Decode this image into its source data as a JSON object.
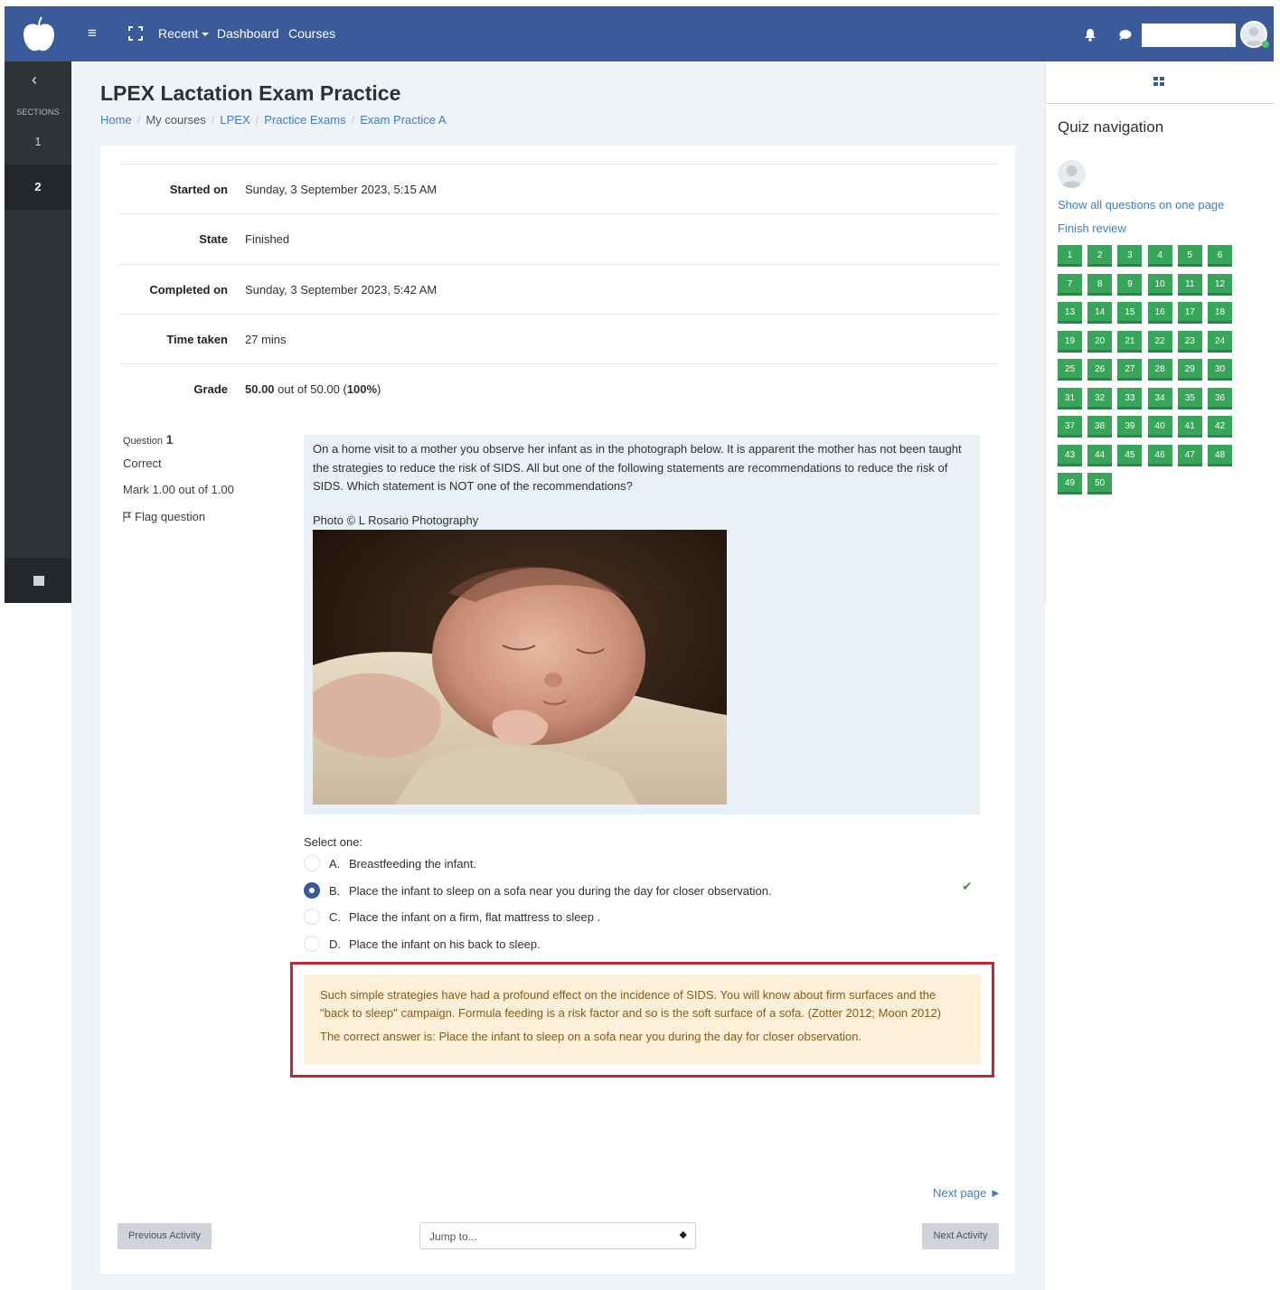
{
  "topnav": {
    "menu_icon": "hamburger-icon",
    "fullscreen_icon": "fullscreen-icon",
    "recent_label": "Recent",
    "dashboard_label": "Dashboard",
    "courses_label": "Courses",
    "notifications_icon": "bell-icon",
    "messages_icon": "chat-bubble-icon",
    "search_value": "",
    "brand_color": "#3a5a99"
  },
  "sections_drawer": {
    "back_icon": "chevron-left-icon",
    "title": "SECTIONS",
    "items": [
      "1",
      "2"
    ],
    "active_item": "2",
    "bottom_icon": "archive-icon"
  },
  "page": {
    "title": "LPEX Lactation Exam Practice",
    "breadcrumb": [
      "Home",
      "My courses",
      "LPEX",
      "Practice Exams",
      "Exam Practice A"
    ]
  },
  "summary": {
    "started_on_label": "Started on",
    "started_on_value": "Sunday, 3 September 2023, 5:15 AM",
    "state_label": "State",
    "state_value": "Finished",
    "completed_on_label": "Completed on",
    "completed_on_value": "Sunday, 3 September 2023, 5:42 AM",
    "time_taken_label": "Time taken",
    "time_taken_value": "27 mins",
    "grade_label": "Grade",
    "grade_score": "50.00",
    "grade_middle": " out of 50.00 (",
    "grade_percent": "100%",
    "grade_end": ")"
  },
  "question": {
    "question_word": "Question",
    "number": "1",
    "status": "Correct",
    "mark": "Mark 1.00 out of 1.00",
    "flag_label": "Flag question",
    "flag_icon": "flag-icon",
    "text": "On a home visit to a mother you observe her infant as in the photograph below. It is apparent the mother has not been taught the strategies to reduce the risk of SIDS. All but one of the following statements are recommendations to reduce the risk of SIDS. Which statement is NOT one of the recommendations?",
    "photo_credit": "Photo © L Rosario Photography",
    "select_one": "Select one:",
    "options": [
      {
        "letter": "A.",
        "text": "Breastfeeding the infant."
      },
      {
        "letter": "B.",
        "text": "Place the infant to sleep on a sofa near you during the day for closer observation."
      },
      {
        "letter": "C.",
        "text": "Place the infant on a firm, flat mattress to sleep ."
      },
      {
        "letter": "D.",
        "text": "Place the infant on his back to sleep."
      }
    ],
    "selected_option": "B.",
    "correct_icon": "checkmark-icon",
    "feedback_general": "Such simple strategies have had a profound effect on the incidence of SIDS. You will know about firm surfaces and the \"back to sleep\" campaign. Formula feeding is a risk factor and so is the soft surface of a sofa. (Zotter 2012; Moon 2012)",
    "feedback_answer": "The correct answer is: Place the infant to sleep on a sofa near you during the day for closer observation.",
    "highlight_color": "#c3272f"
  },
  "footer": {
    "next_page": "Next page ►",
    "previous_activity": "Previous Activity",
    "jump_to": "Jump to...",
    "next_activity": "Next Activity"
  },
  "quiz_nav": {
    "toggle_icon": "grid-icon",
    "title": "Quiz navigation",
    "show_all": "Show all questions on one page",
    "finish_review": "Finish review",
    "questions": [
      "1",
      "2",
      "3",
      "4",
      "5",
      "6",
      "7",
      "8",
      "9",
      "10",
      "11",
      "12",
      "13",
      "14",
      "15",
      "16",
      "17",
      "18",
      "19",
      "20",
      "21",
      "22",
      "23",
      "24",
      "25",
      "26",
      "27",
      "28",
      "29",
      "30",
      "31",
      "32",
      "33",
      "34",
      "35",
      "36",
      "37",
      "38",
      "39",
      "40",
      "41",
      "42",
      "43",
      "44",
      "45",
      "46",
      "47",
      "48",
      "49",
      "50"
    ],
    "correct_color": "#37a55a"
  }
}
